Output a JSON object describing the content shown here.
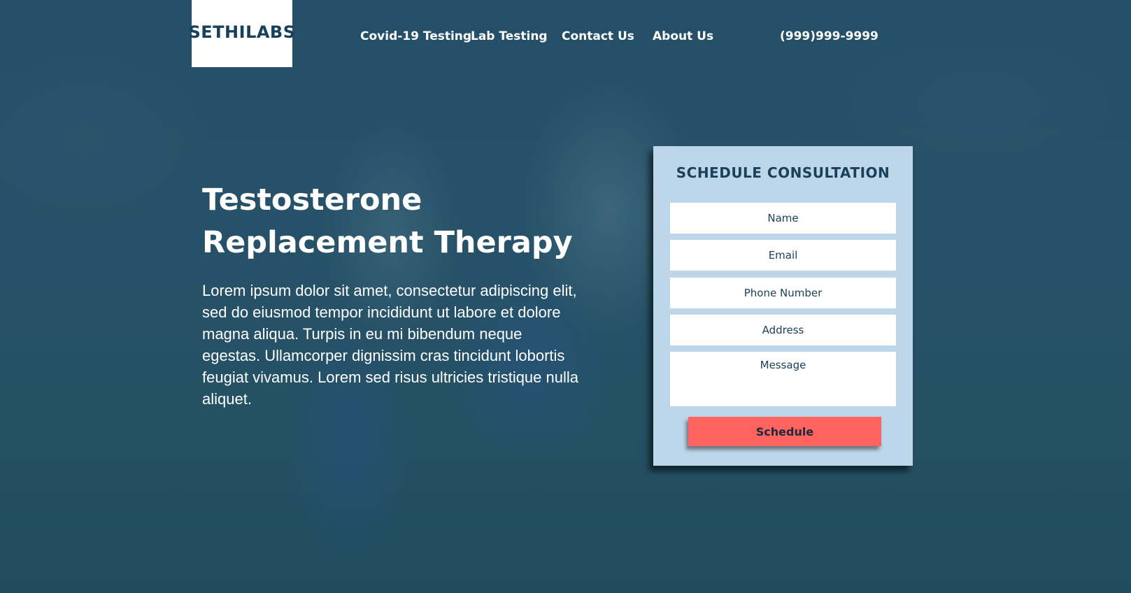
{
  "header": {
    "logo_text": "SETHILABS",
    "nav": [
      {
        "label": "Covid-19 Testing"
      },
      {
        "label": "Lab Testing"
      },
      {
        "label": "Contact Us"
      },
      {
        "label": "About Us"
      }
    ],
    "phone": "(999)999-9999"
  },
  "hero": {
    "title": "Testosterone Replacement Therapy",
    "body": "Lorem ipsum dolor sit amet, consectetur adipiscing elit, sed do eiusmod tempor incididunt ut labore et dolore magna aliqua. Turpis in eu mi bibendum neque egestas. Ullamcorper dignissim cras tincidunt lobortis feugiat vivamus. Lorem sed risus ultricies tristique nulla aliquet."
  },
  "form": {
    "title": "SCHEDULE CONSULTATION",
    "name_placeholder": "Name",
    "email_placeholder": "Email",
    "phone_placeholder": "Phone Number",
    "address_placeholder": "Address",
    "message_placeholder": "Message",
    "submit_label": "Schedule"
  },
  "colors": {
    "navy": "#17405a",
    "form_bg": "#bed6ea",
    "button": "#ff6461",
    "white": "#ffffff"
  }
}
